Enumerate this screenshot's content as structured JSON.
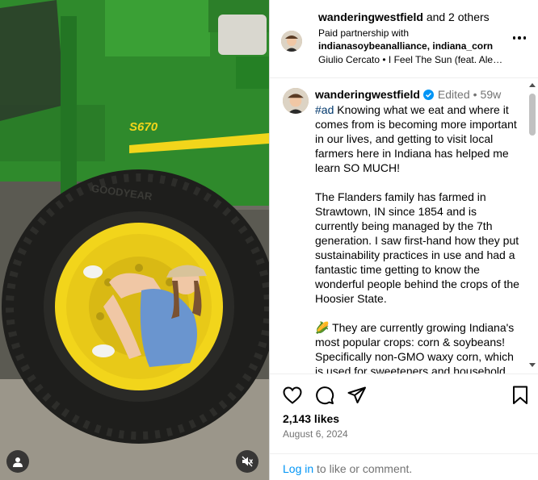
{
  "media": {
    "machine_model": "S670",
    "tire_brand": "GOODYEAR",
    "colors": {
      "green": "#2f8a2c",
      "yellow": "#f2d51b",
      "tire": "#1e1e1c"
    }
  },
  "header": {
    "username": "wanderingwestfield",
    "and_others": "and 2 others",
    "partnership_prefix": "Paid partnership with",
    "partners": "indianasoybeanalliance, indiana_corn",
    "audio": "Giulio Cercato • I Feel The Sun (feat. Alex..."
  },
  "caption": {
    "username": "wanderingwestfield",
    "edited": "Edited",
    "separator": "•",
    "age": "59w",
    "hashtag": "#ad",
    "p1_rest": " Knowing what we eat and where it comes from is becoming more important in our lives, and getting to visit local farmers here in Indiana has helped me learn SO MUCH!",
    "p2": "The Flanders family has farmed in Strawtown, IN since 1854 and is currently being managed by the 7th generation. I saw first-hand how they put sustainability practices in use and had a fantastic time getting to know the wonderful people behind the crops of the Hoosier State.",
    "p3": "🌽 They are currently growing Indiana's most popular crops: corn & soybeans! Specifically non-GMO waxy corn, which is used for sweeteners and household"
  },
  "engagement": {
    "likes": "2,143 likes",
    "date": "August 6, 2024"
  },
  "footer": {
    "login": "Log in",
    "rest": " to like or comment."
  },
  "icons": {
    "like": "heart-icon",
    "comment": "comment-icon",
    "share": "share-icon",
    "save": "bookmark-icon",
    "more": "more-icon",
    "tag": "user-tag-icon",
    "mute": "muted-speaker-icon",
    "verified": "verified-badge-icon"
  },
  "colors": {
    "link": "#0095f6",
    "hashtag": "#00376b",
    "muted": "#737373",
    "verified": "#0095f6"
  }
}
